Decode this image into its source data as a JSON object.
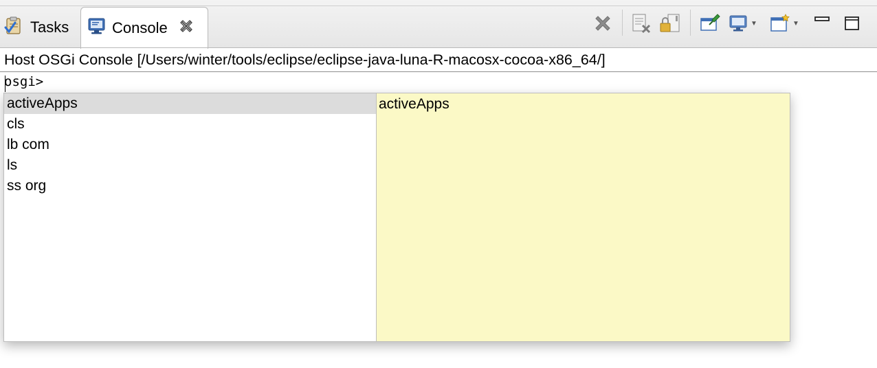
{
  "tabs": [
    {
      "label": "Tasks",
      "icon": "tasks-icon",
      "active": false
    },
    {
      "label": "Console",
      "icon": "console-icon",
      "active": true
    }
  ],
  "toolbar": {
    "buttons": [
      "terminate-icon",
      "remove-launch-icon",
      "scroll-lock-icon",
      "pin-console-icon",
      "display-console-icon",
      "open-console-icon",
      "minimize-icon",
      "maximize-icon"
    ]
  },
  "console": {
    "title": "Host OSGi Console [/Users/winter/tools/eclipse/eclipse-java-luna-R-macosx-cocoa-x86_64/]",
    "prompt": "osgi>"
  },
  "completion": {
    "proposals": [
      "activeApps",
      "cls",
      "lb com",
      "ls",
      "ss org"
    ],
    "selected_index": 0,
    "info_text": "activeApps"
  },
  "colors": {
    "info_background": "#fbf9c6",
    "selected_background": "#dcdcdc",
    "console_icon_blue": "#3f6fb5"
  }
}
